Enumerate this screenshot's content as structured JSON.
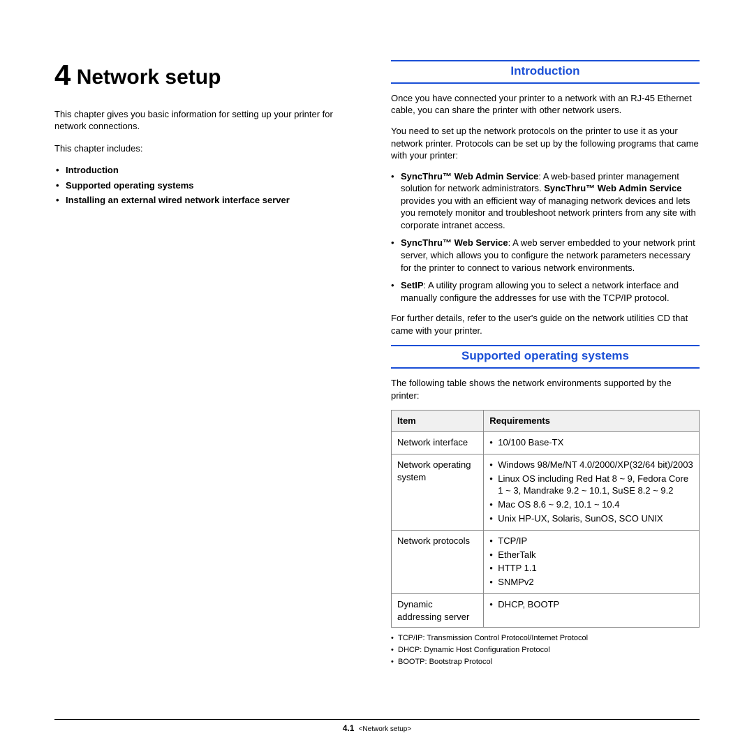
{
  "chapter": {
    "number": "4",
    "title": "Network setup",
    "intro": "This chapter gives you basic information for setting up your printer for network connections.",
    "includes_label": "This chapter includes:",
    "toc": [
      "Introduction",
      "Supported operating systems",
      "Installing an external wired network interface server"
    ]
  },
  "intro_section": {
    "heading": "Introduction",
    "p1": "Once you have connected your printer to a network with an RJ-45 Ethernet cable, you can share the printer with other network users.",
    "p2": "You need to set up the network protocols on the printer to use it as your network printer. Protocols can be set up by the following programs that came with your printer:",
    "items": [
      {
        "bold1": "SyncThru™ Web Admin Service",
        "t1": ": A web-based printer management solution for network administrators. ",
        "bold2": "SyncThru™ Web Admin Service",
        "t2": " provides you with an efficient way of managing network devices and lets you remotely monitor and troubleshoot network printers from any site with corporate intranet access."
      },
      {
        "bold1": "SyncThru™ Web Service",
        "t1": ": A web server embedded to your network print server, which allows you to configure the network parameters necessary for the printer to connect to various network environments.",
        "bold2": "",
        "t2": ""
      },
      {
        "bold1": "SetIP",
        "t1": ": A utility program allowing you to select a network interface and manually configure the addresses for use with the TCP/IP protocol.",
        "bold2": "",
        "t2": ""
      }
    ],
    "p3": "For further details, refer to the user's guide on the network utilities CD that came with your printer."
  },
  "supported_section": {
    "heading": "Supported operating systems",
    "intro": "The following table shows the network environments supported by the printer:",
    "table": {
      "head_item": "Item",
      "head_req": "Requirements",
      "rows": [
        {
          "item": "Network interface",
          "reqs": [
            "10/100 Base-TX"
          ]
        },
        {
          "item": "Network operating system",
          "reqs": [
            "Windows 98/Me/NT 4.0/2000/XP(32/64 bit)/2003",
            "Linux OS including Red Hat 8 ~ 9, Fedora Core 1 ~ 3, Mandrake 9.2 ~ 10.1, SuSE 8.2 ~ 9.2",
            "Mac OS 8.6 ~ 9.2, 10.1 ~ 10.4",
            "Unix HP-UX, Solaris, SunOS, SCO UNIX"
          ]
        },
        {
          "item": "Network protocols",
          "reqs": [
            "TCP/IP",
            "EtherTalk",
            "HTTP 1.1",
            "SNMPv2"
          ]
        },
        {
          "item": "Dynamic addressing server",
          "reqs": [
            "DHCP, BOOTP"
          ]
        }
      ]
    },
    "footnotes": [
      "TCP/IP: Transmission Control Protocol/Internet Protocol",
      "DHCP: Dynamic Host Configuration Protocol",
      "BOOTP: Bootstrap Protocol"
    ]
  },
  "footer": {
    "page": "4.1",
    "crumb": "<Network setup>"
  }
}
